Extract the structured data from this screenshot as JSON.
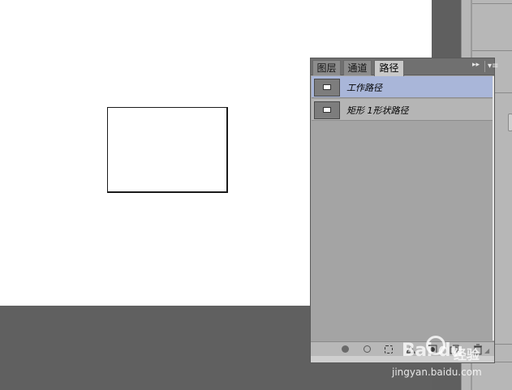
{
  "panel": {
    "tabs": [
      {
        "label": "图层"
      },
      {
        "label": "通道"
      },
      {
        "label": "路径"
      }
    ],
    "tab_arrows": "▸▸",
    "menu_glyph": "▾≡",
    "paths": [
      {
        "label": "工作路径",
        "selected": true
      },
      {
        "label": "矩形 1形状路径",
        "selected": false
      }
    ],
    "toolbar_icons": [
      "fill-path-icon",
      "stroke-path-icon",
      "load-as-selection-icon",
      "make-work-path-icon",
      "add-mask-icon",
      "new-path-icon",
      "delete-path-icon"
    ],
    "selected_row_color": "#a9b6d9"
  },
  "watermark": {
    "logo": "Bai du",
    "chinese": "经验",
    "url": "jingyan.baidu.com"
  }
}
